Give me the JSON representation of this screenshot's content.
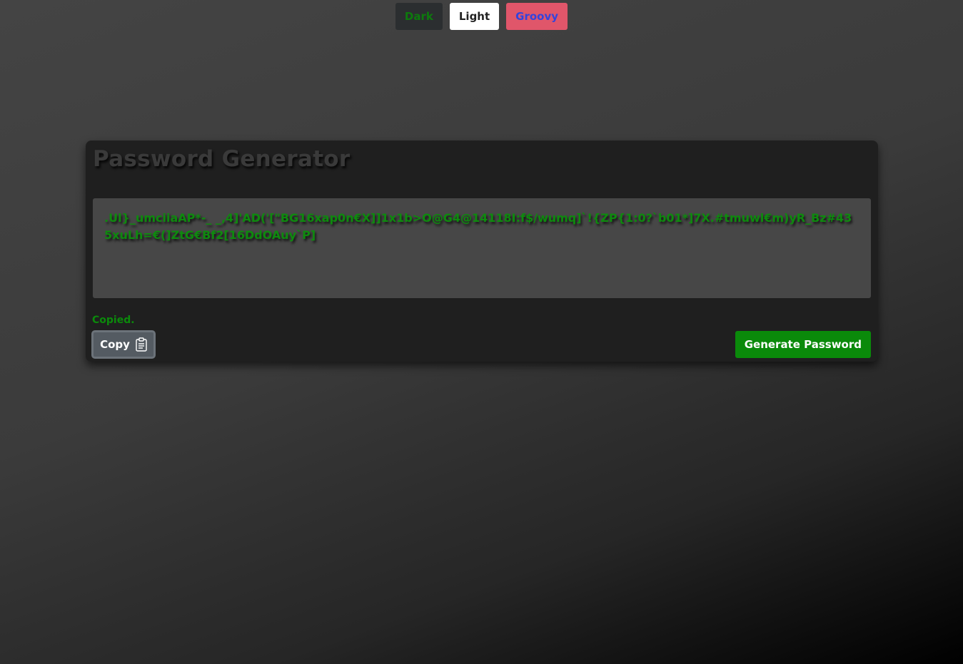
{
  "themes": {
    "dark_label": "Dark",
    "light_label": "Light",
    "groovy_label": "Groovy"
  },
  "card": {
    "title": "Password Generator",
    "password": ".Ul}_umciiaAP*-_ _,4]'AD('[\"BG16xap0n€X]]1x1b>O@G4@14118I:f$/wumq]`!{ZP{1:0?`b01*]7X.#tmuwl€m)yR_Bz#435xuLh=€(]ZtG€Bf2[16DdOAuy`P]",
    "copied_message": "Copied.",
    "copy_label": "Copy",
    "generate_label": "Generate Password"
  },
  "colors": {
    "accent_green": "#0a8a0a",
    "card_bg": "#1f1f1f",
    "textarea_bg": "#474747",
    "groovy_bg": "#e0566a"
  },
  "icons": {
    "copy": "clipboard-icon"
  }
}
